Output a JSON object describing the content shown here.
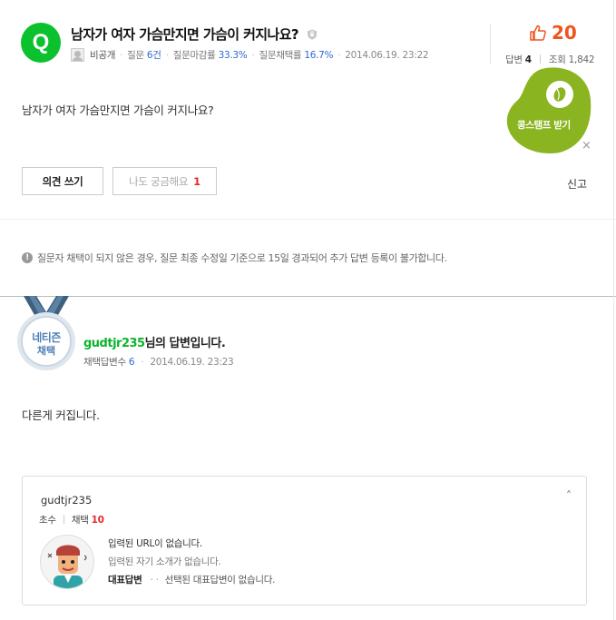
{
  "colors": {
    "brand_green": "#0bc12d",
    "like_orange": "#f0531f",
    "link_blue": "#2b6cd1",
    "count_red": "#e22a2a",
    "medal_blue": "#4a7fb5"
  },
  "question": {
    "badge": "Q",
    "title": "남자가 여자 가슴만지면 가슴이 커지나요?",
    "author": "비공개",
    "meta": [
      {
        "label": "질문",
        "value": "6건"
      },
      {
        "label": "질문마감률",
        "value": "33.3%"
      },
      {
        "label": "질문채택률",
        "value": "16.7%"
      }
    ],
    "date": "2014.06.19. 23:22",
    "body": "남자가 여자 가슴만지면 가슴이 커지나요?",
    "likes": "20",
    "answers_label": "답변",
    "answers_count": "4",
    "views_label": "조회",
    "views_count": "1,842"
  },
  "coupon": {
    "label": "콩스탬프 받기",
    "close": "×",
    "icon": "coffee-bean-icon"
  },
  "actions": {
    "opinion_button": "의견 쓰기",
    "curious_button": "나도 궁금해요",
    "curious_count": "1",
    "report": "신고"
  },
  "notice": {
    "icon": "!",
    "text": "질문자 채택이 되지 않은 경우, 질문 최종 수정일 기준으로 15일 경과되어 추가 답변 등록이 불가합니다."
  },
  "answer": {
    "medal_line1": "네티즌",
    "medal_line2": "채택",
    "username": "gudtjr235",
    "title_suffix": "님의 답변입니다.",
    "adopted_label": "채택답변수",
    "adopted_count": "6",
    "date": "2014.06.19. 23:23",
    "body": "다른게 커집니다."
  },
  "profile": {
    "name": "gudtjr235",
    "toggle": "˄",
    "grade": "초수",
    "adopt_label": "채택",
    "adopt_count": "10",
    "url_text": "입력된 URL이 없습니다.",
    "intro_text": "입력된 자기 소개가 없습니다.",
    "rep_label": "대표답변",
    "rep_dots": "· ·",
    "rep_text": "선택된 대표답변이 없습니다."
  }
}
